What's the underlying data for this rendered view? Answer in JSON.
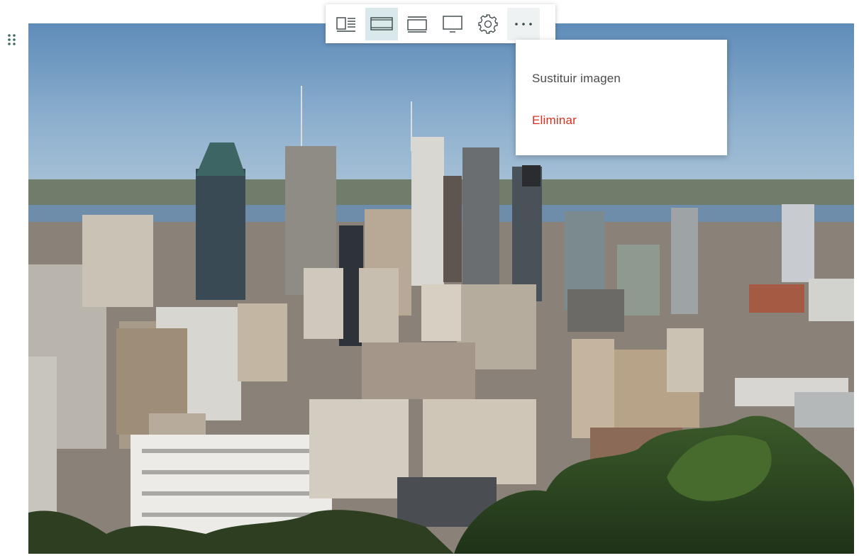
{
  "toolbar": {
    "buttons": [
      {
        "id": "float",
        "icon": "layout-float-icon"
      },
      {
        "id": "standard",
        "icon": "layout-standard-icon",
        "active": true
      },
      {
        "id": "wide",
        "icon": "layout-wide-icon"
      },
      {
        "id": "full",
        "icon": "layout-full-icon"
      },
      {
        "id": "settings",
        "icon": "gear-icon"
      },
      {
        "id": "more",
        "icon": "more-options-icon"
      }
    ]
  },
  "menu": {
    "replace_label": "Sustituir imagen",
    "delete_label": "Eliminar"
  },
  "colors": {
    "active_button_bg": "#d9e8ea",
    "danger_text": "#d83020",
    "menu_text": "#4a4a4a",
    "icon_stroke": "#3a4548"
  },
  "image": {
    "subject": "city-skyline-photo"
  }
}
